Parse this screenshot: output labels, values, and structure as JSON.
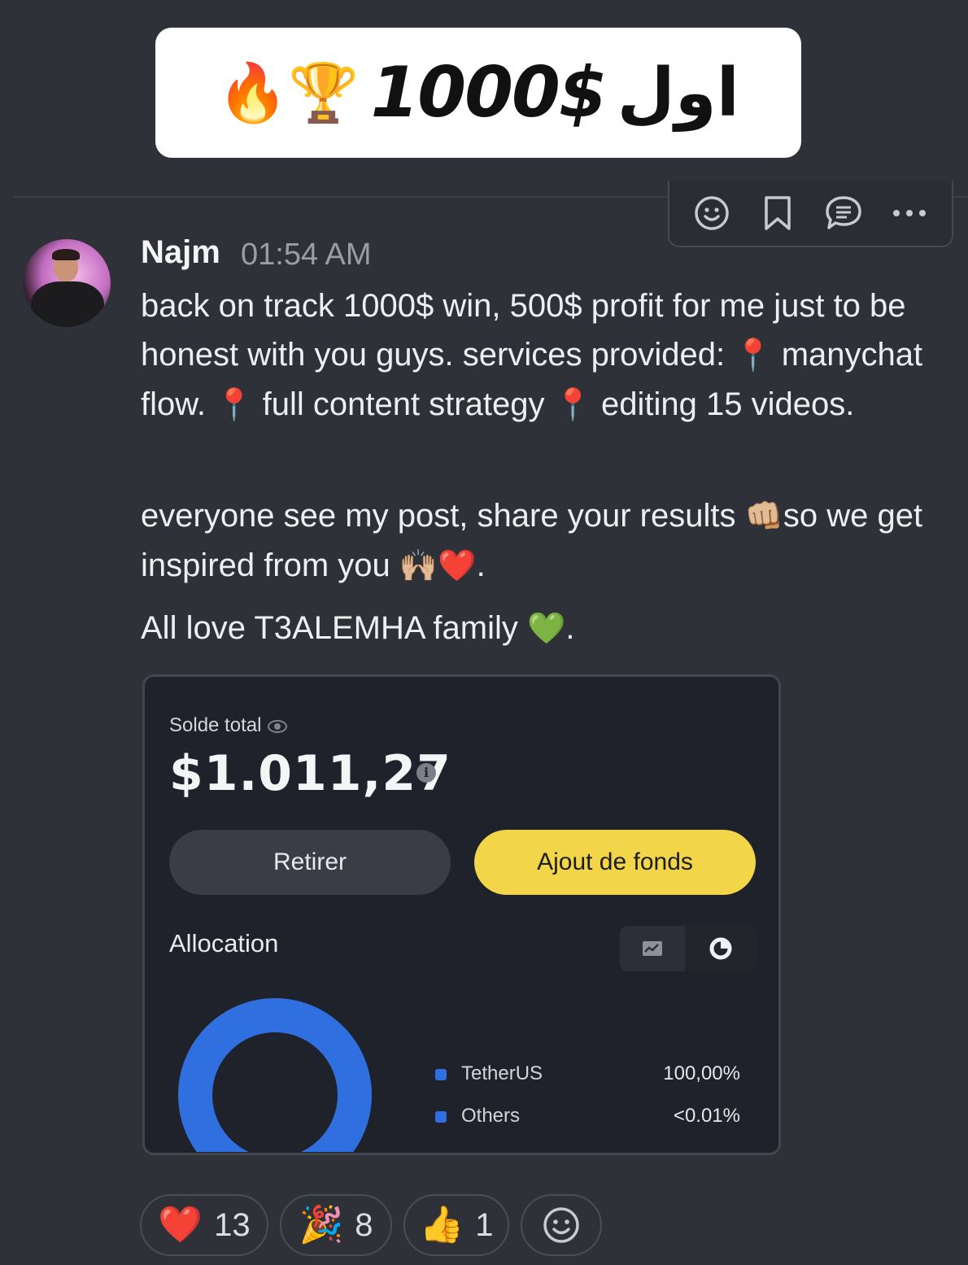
{
  "banner": {
    "arabic": "اول",
    "amount": "1000$",
    "emoji": "🔥🏆"
  },
  "toolbar": {
    "icons": [
      "emoji-react-icon",
      "bookmark-icon",
      "reply-thread-icon",
      "more-icon"
    ]
  },
  "message": {
    "author": "Najm",
    "time": "01:54 AM",
    "p1": {
      "a": "back on track 1000$ win, 500$ profit for me just to be honest with you guys. services provided: ",
      "pin1": "📍",
      "b": " manychat flow. ",
      "pin2": "📍",
      "c": " full content strategy ",
      "pin3": "📍",
      "d": "  editing 15 videos."
    },
    "p2": {
      "a": "everyone see my post, share your results ",
      "fist": "👊🏼",
      "b": "so we get inspired from you ",
      "hands": "🙌🏼",
      "heart": "❤️",
      "c": "."
    },
    "p3": {
      "a": "All love T3ALEMHA family ",
      "green_heart": "💚",
      "b": "."
    }
  },
  "screenshot": {
    "solde_label": "Solde total",
    "balance": "$1.011,27",
    "info_glyph": "i",
    "retirer": "Retirer",
    "ajout": "Ajout de fonds",
    "allocation": "Allocation",
    "accent_yellow": "#f3d54a",
    "accent_blue": "#2f6fe0",
    "chart_data": {
      "type": "pie",
      "categories": [
        "TetherUS",
        "Others"
      ],
      "labels": [
        "100,00%",
        "<0.01%"
      ],
      "values": [
        100.0,
        0.01
      ]
    }
  },
  "reactions": [
    {
      "emoji": "❤️",
      "count": "13"
    },
    {
      "emoji": "🎉",
      "count": "8"
    },
    {
      "emoji": "👍",
      "count": "1"
    }
  ]
}
